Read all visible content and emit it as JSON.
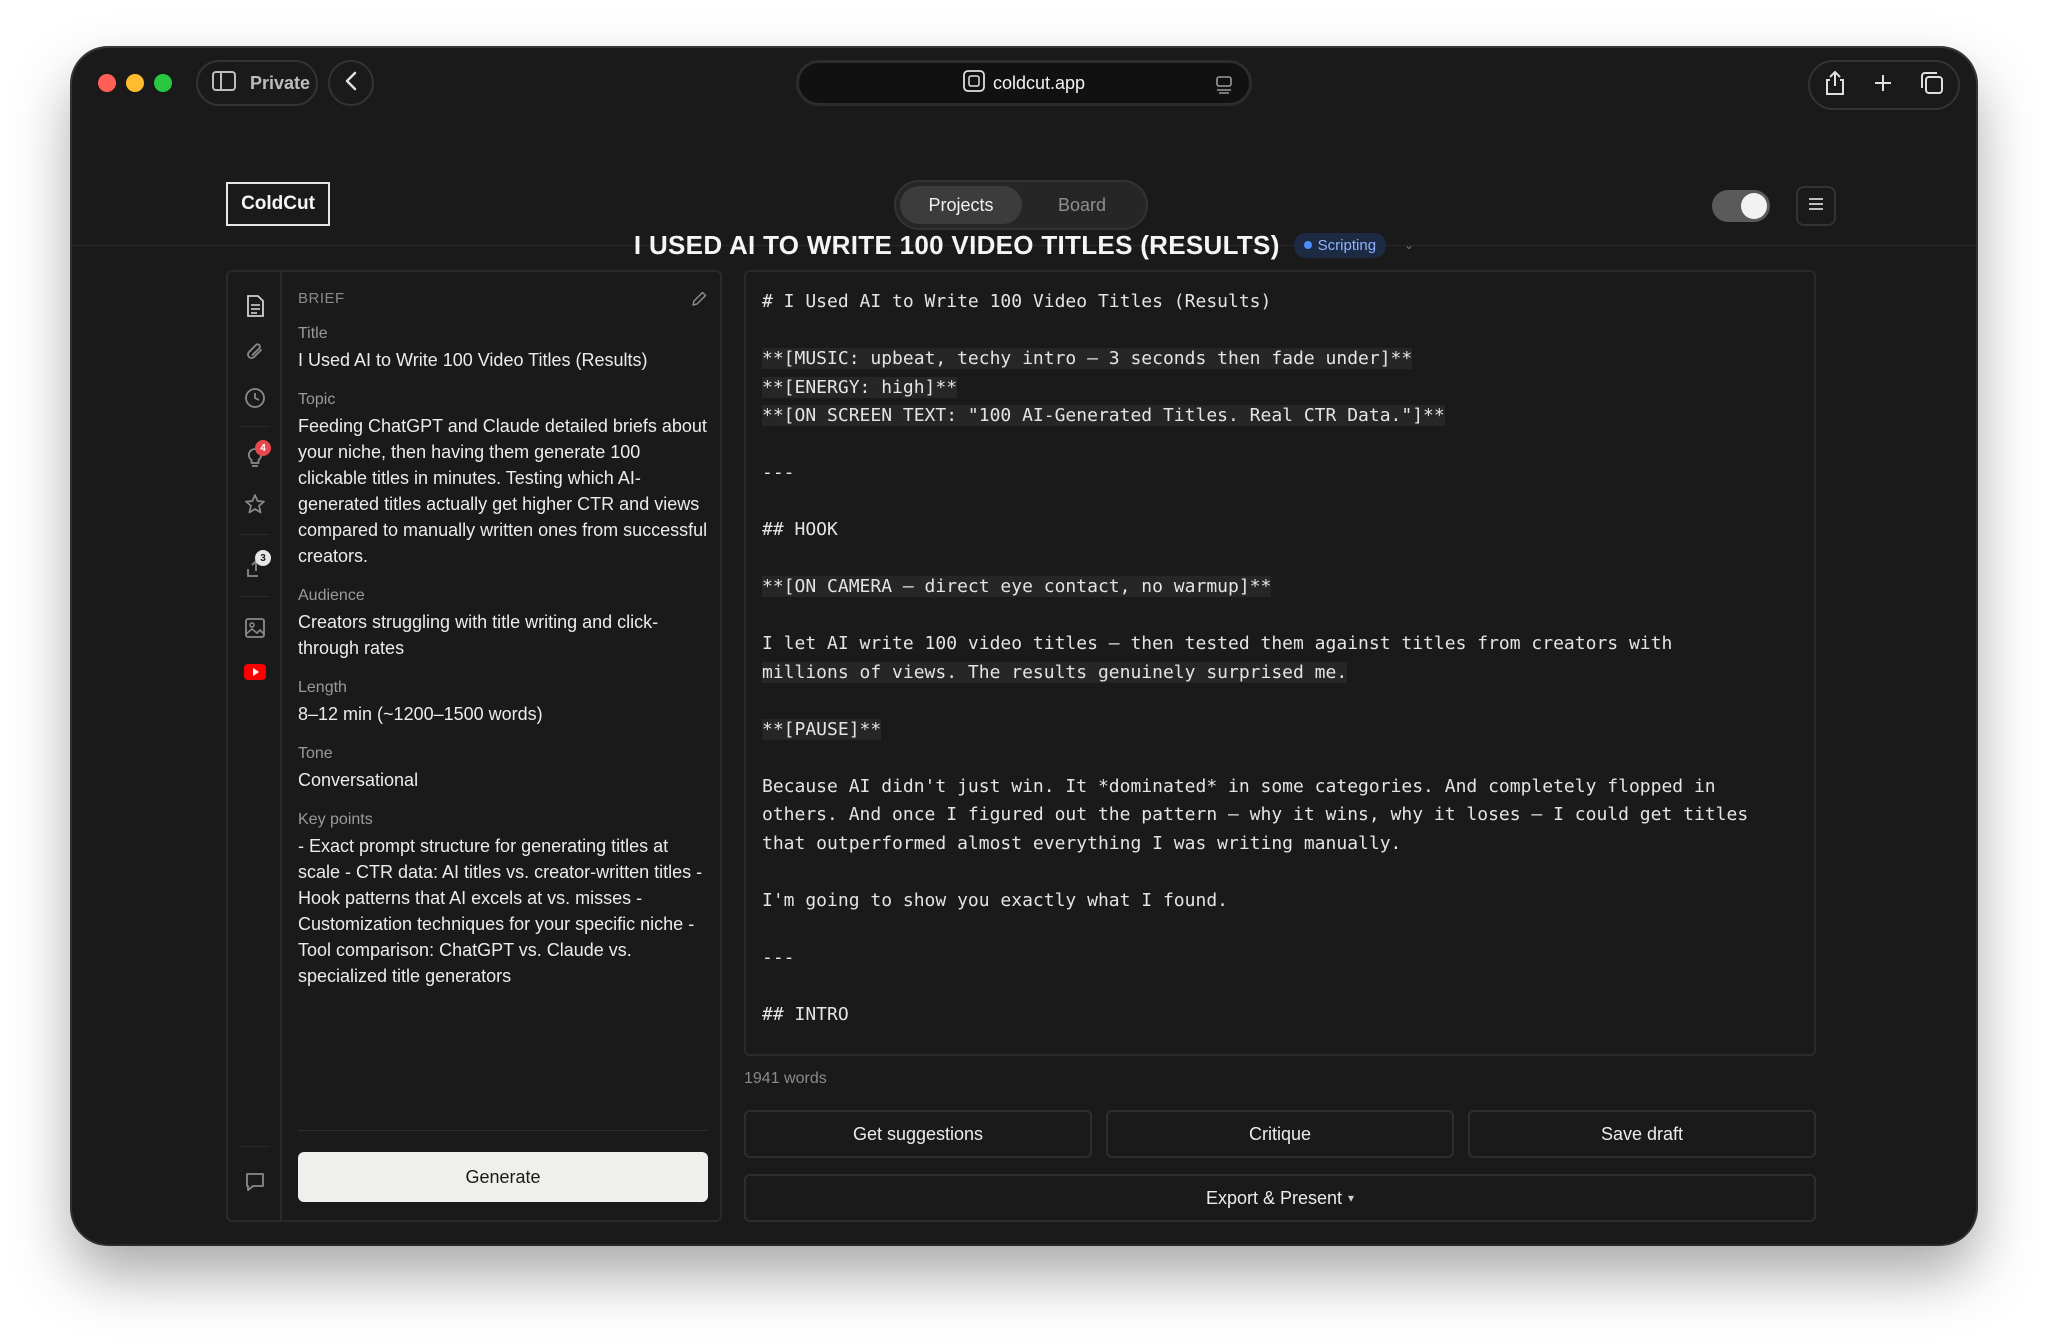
{
  "browser": {
    "private_label": "Private",
    "url": "coldcut.app"
  },
  "app": {
    "logo": "ColdCut",
    "tabs": [
      {
        "label": "Projects",
        "active": true
      },
      {
        "label": "Board",
        "active": false
      }
    ],
    "theme_toggle": "on"
  },
  "project": {
    "title": "I USED AI TO WRITE 100 VIDEO TITLES (RESULTS)",
    "status": "Scripting",
    "status_color": "#4d8bff"
  },
  "rail": {
    "icons": [
      "document-icon",
      "paperclip-icon",
      "clock-icon",
      "lightbulb-icon",
      "star-icon",
      "share-icon",
      "image-icon",
      "youtube-icon",
      "comment-icon"
    ],
    "badges": {
      "lightbulb": "4",
      "share": "3"
    },
    "badge_colors": {
      "lightbulb": "#e5484d",
      "share": "#e6e6e6"
    }
  },
  "brief": {
    "heading": "BRIEF",
    "fields": [
      {
        "label": "Title",
        "value": "I Used AI to Write 100 Video Titles (Results)"
      },
      {
        "label": "Topic",
        "value": "Feeding ChatGPT and Claude detailed briefs about your niche, then having them generate 100 clickable titles in minutes. Testing which AI-generated titles actually get higher CTR and views compared to manually written ones from successful creators."
      },
      {
        "label": "Audience",
        "value": "Creators struggling with title writing and click-through rates"
      },
      {
        "label": "Length",
        "value": "8–12 min (~1200–1500 words)"
      },
      {
        "label": "Tone",
        "value": "Conversational"
      },
      {
        "label": "Key points",
        "value": "- Exact prompt structure for generating titles at scale - CTR data: AI titles vs. creator-written titles - Hook patterns that AI excels at vs. misses - Customization techniques for your specific niche - Tool comparison: ChatGPT vs. Claude vs. specialized title generators"
      }
    ],
    "generate_label": "Generate"
  },
  "editor": {
    "lines": [
      {
        "text": "# I Used AI to Write 100 Video Titles (Results)",
        "hl": false
      },
      {
        "text": "",
        "hl": false
      },
      {
        "text": "**[MUSIC: upbeat, techy intro — 3 seconds then fade under]**",
        "hl": true
      },
      {
        "text": "**[ENERGY: high]**",
        "hl": true
      },
      {
        "text": "**[ON SCREEN TEXT: \"100 AI-Generated Titles. Real CTR Data.\"]**",
        "hl": true
      },
      {
        "text": "",
        "hl": false
      },
      {
        "text": "---",
        "hl": false
      },
      {
        "text": "",
        "hl": false
      },
      {
        "text": "## HOOK",
        "hl": false
      },
      {
        "text": "",
        "hl": false
      },
      {
        "text": "**[ON CAMERA — direct eye contact, no warmup]**",
        "hl": true
      },
      {
        "text": "",
        "hl": false
      },
      {
        "text": "I let AI write 100 video titles — then tested them against titles from creators with",
        "hl": false
      },
      {
        "text": "millions of views. The results genuinely surprised me.",
        "hl": true
      },
      {
        "text": "",
        "hl": false
      },
      {
        "text": "**[PAUSE]**",
        "hl": true
      },
      {
        "text": "",
        "hl": false
      },
      {
        "text": "Because AI didn't just win. It *dominated* in some categories. And completely flopped in",
        "hl": false
      },
      {
        "text": "others. And once I figured out the pattern — why it wins, why it loses — I could get titles",
        "hl": false
      },
      {
        "text": "that outperformed almost everything I was writing manually.",
        "hl": false
      },
      {
        "text": "",
        "hl": false
      },
      {
        "text": "I'm going to show you exactly what I found.",
        "hl": false
      },
      {
        "text": "",
        "hl": false
      },
      {
        "text": "---",
        "hl": false
      },
      {
        "text": "",
        "hl": false
      },
      {
        "text": "## INTRO",
        "hl": false
      }
    ],
    "word_count": "1941 words"
  },
  "actions": {
    "get_suggestions": "Get suggestions",
    "critique": "Critique",
    "save_draft": "Save draft",
    "export_present": "Export & Present",
    "export_caret": "▾"
  }
}
